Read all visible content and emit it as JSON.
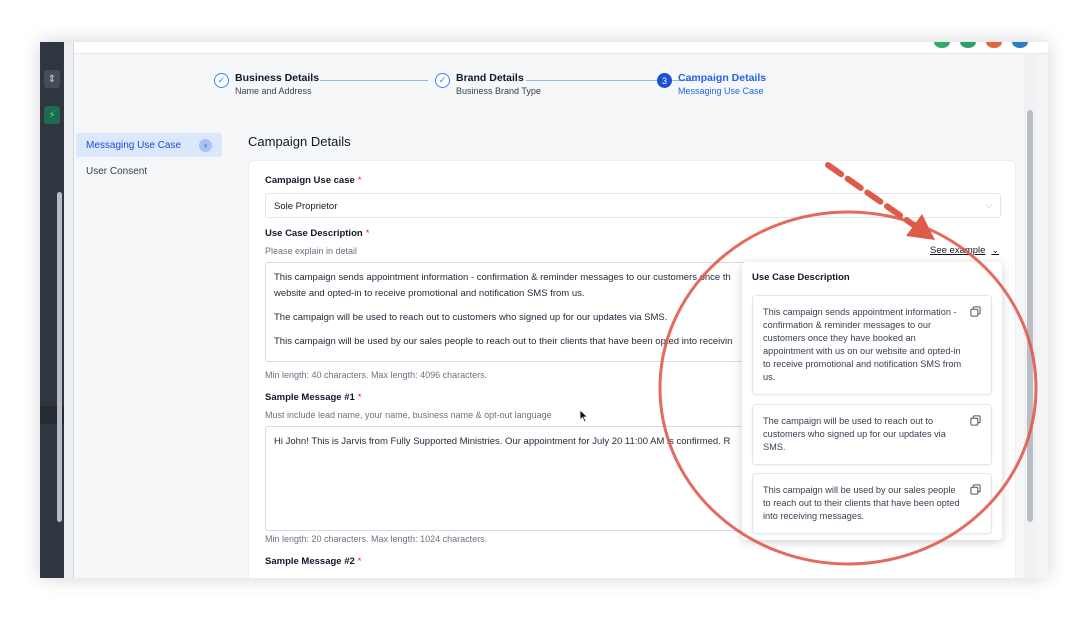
{
  "stepper": {
    "steps": [
      {
        "number": "",
        "title": "Business Details",
        "subtitle": "Name and Address",
        "state": "done"
      },
      {
        "number": "",
        "title": "Brand Details",
        "subtitle": "Business Brand Type",
        "state": "done"
      },
      {
        "number": "3",
        "title": "Campaign Details",
        "subtitle": "Messaging Use Case",
        "state": "active"
      }
    ]
  },
  "sidebar": {
    "items": [
      {
        "label": "Messaging Use Case",
        "active": true
      },
      {
        "label": "User Consent",
        "active": false
      }
    ]
  },
  "main": {
    "section_title": "Campaign Details",
    "campaign_use_case": {
      "label": "Campaign Use case",
      "required_mark": "*",
      "value": "Sole Proprietor"
    },
    "use_case_description": {
      "label": "Use Case Description",
      "required_mark": "*",
      "hint": "Please explain in detail",
      "see_example": "See example",
      "lines": [
        "This campaign sends appointment information - confirmation & reminder messages to our customers once th",
        "website and opted-in to receive promotional and notification SMS from us.",
        "The campaign will be used to reach out to customers who signed up for our updates via SMS.",
        "This campaign will be used by our sales people to reach out to their clients that have been opted into receivin"
      ],
      "length_hint": "Min length: 40 characters. Max length: 4096 characters."
    },
    "sample_message_1": {
      "label": "Sample Message #1",
      "required_mark": "*",
      "hint": "Must include lead name, your name, business name & opt-out language",
      "value": "Hi John! This is Jarvis from Fully Supported Ministries. Our appointment for July 20 11:00 AM is confirmed. R",
      "length_hint": "Min length: 20 characters. Max length: 1024 characters."
    },
    "sample_message_2": {
      "label": "Sample Message #2",
      "required_mark": "*"
    }
  },
  "popover": {
    "title": "Use Case Description",
    "examples": [
      "This campaign sends appointment information - confirmation & reminder messages to our customers once they have booked an appointment with us on our website and opted-in to receive promotional and notification SMS from us.",
      "The campaign will be used to reach out to customers who signed up for our updates via SMS.",
      "This campaign will be used by our sales people to reach out to their clients that have been opted into receiving messages."
    ],
    "copy_icon": "copy-icon"
  },
  "colors": {
    "accent": "#1d4ed8",
    "required": "#dc2626",
    "annotation": "#e05a4a"
  }
}
